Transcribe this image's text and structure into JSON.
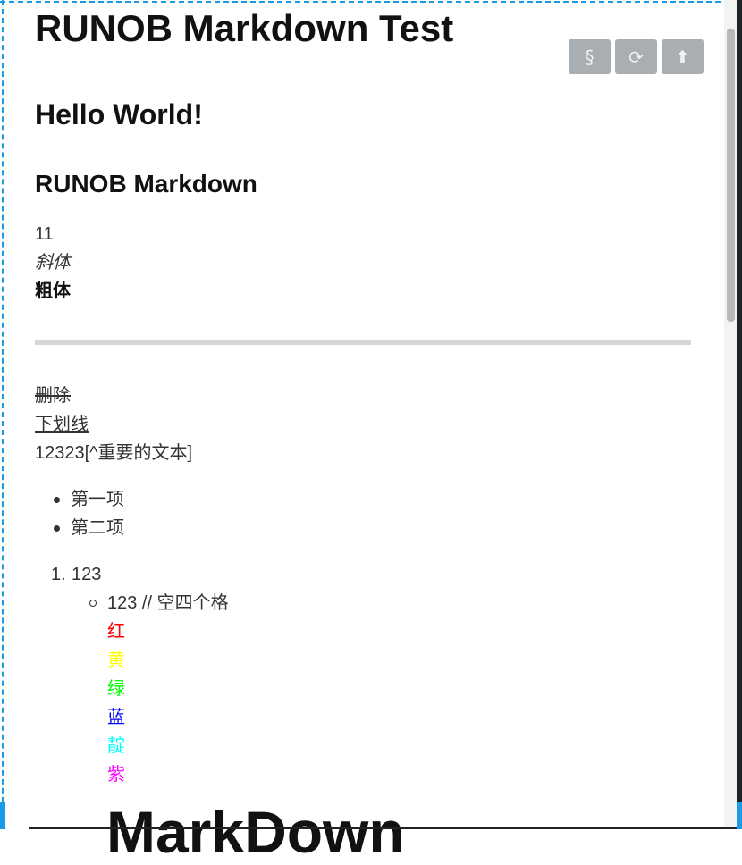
{
  "toolbar": {
    "toc_icon": "§",
    "refresh_icon": "⟳",
    "top_icon": "⬆"
  },
  "doc": {
    "title": "RUNOB Markdown Test",
    "h2": "Hello World!",
    "h3": "RUNOB Markdown",
    "line_11": "11",
    "italic": "斜体",
    "bold": "粗体",
    "strikethrough": "删除",
    "underline": "下划线",
    "footnote": "12323[^重要的文本]",
    "bullets": [
      "第一项",
      "第二项"
    ],
    "ordered_marker": "1.",
    "ordered_item": "123",
    "sub_item": "123 // 空四个格",
    "colors": [
      {
        "text": "红",
        "color": "#ff0000"
      },
      {
        "text": "黄",
        "color": "#ffff00"
      },
      {
        "text": "绿",
        "color": "#00ff00"
      },
      {
        "text": "蓝",
        "color": "#0000ff"
      },
      {
        "text": "靛",
        "color": "#00ffff"
      },
      {
        "text": "紫",
        "color": "#ff00ff"
      }
    ],
    "big_heading": "MarkDown"
  }
}
